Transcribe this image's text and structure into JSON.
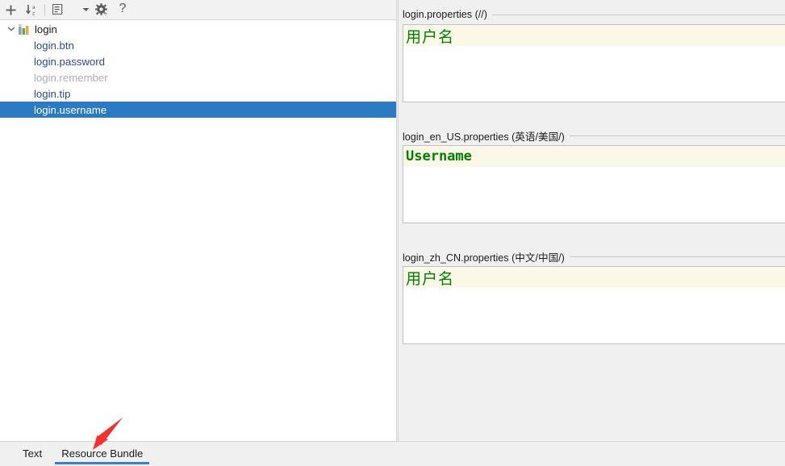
{
  "toolbar": {
    "buttons": [
      {
        "name": "add-property-button",
        "icon": "plus-icon",
        "label": "+"
      },
      {
        "name": "sort-az-button",
        "icon": "sort-alpha-down-icon",
        "label": ""
      },
      {
        "name": "group-by-button",
        "icon": "tree-list-icon",
        "label": ""
      },
      {
        "name": "toolbar-dropdown-button",
        "icon": "chevron-down-icon",
        "label": ""
      },
      {
        "name": "settings-button",
        "icon": "gear-icon",
        "label": ""
      },
      {
        "name": "help-button",
        "icon": "question-mark-icon",
        "label": "?"
      }
    ]
  },
  "tree": {
    "root": {
      "label": "login",
      "icon": "resource-bundle-icon",
      "expanded": true,
      "twisty": "chevron-down-icon"
    },
    "items": [
      {
        "label": "login.btn",
        "state": "normal",
        "selected": false
      },
      {
        "label": "login.password",
        "state": "normal",
        "selected": false
      },
      {
        "label": "login.remember",
        "state": "inactive",
        "selected": false
      },
      {
        "label": "login.tip",
        "state": "normal",
        "selected": false
      },
      {
        "label": "login.username",
        "state": "normal",
        "selected": true
      }
    ]
  },
  "locales": [
    {
      "title": "login.properties (//)",
      "file": "login.properties",
      "locale": "//",
      "value": "用户名",
      "script": "cjk"
    },
    {
      "title": "login_en_US.properties (英语/美国/)",
      "file": "login_en_US.properties",
      "locale": "英语/美国/",
      "value": "Username",
      "script": "latin"
    },
    {
      "title": "login_zh_CN.properties (中文/中国/)",
      "file": "login_zh_CN.properties",
      "locale": "中文/中国/",
      "value": "用户名",
      "script": "cjk"
    }
  ],
  "bottom_tabs": [
    {
      "label": "Text",
      "active": false
    },
    {
      "label": "Resource Bundle",
      "active": true
    }
  ],
  "colors": {
    "selection_blue": "#2a7ac4",
    "tab_underline_blue": "#3d7dca",
    "value_green": "#008000",
    "caret_line_yellow": "#fbf8e8",
    "tree_link_blue": "#2a4c8f",
    "inactive_gray": "#aeaeae",
    "panel_gray": "#f0f0f0",
    "annotation_red": "#f3322c"
  },
  "annotation": {
    "type": "arrow",
    "points_to": "Resource Bundle",
    "color": "#f3322c"
  }
}
